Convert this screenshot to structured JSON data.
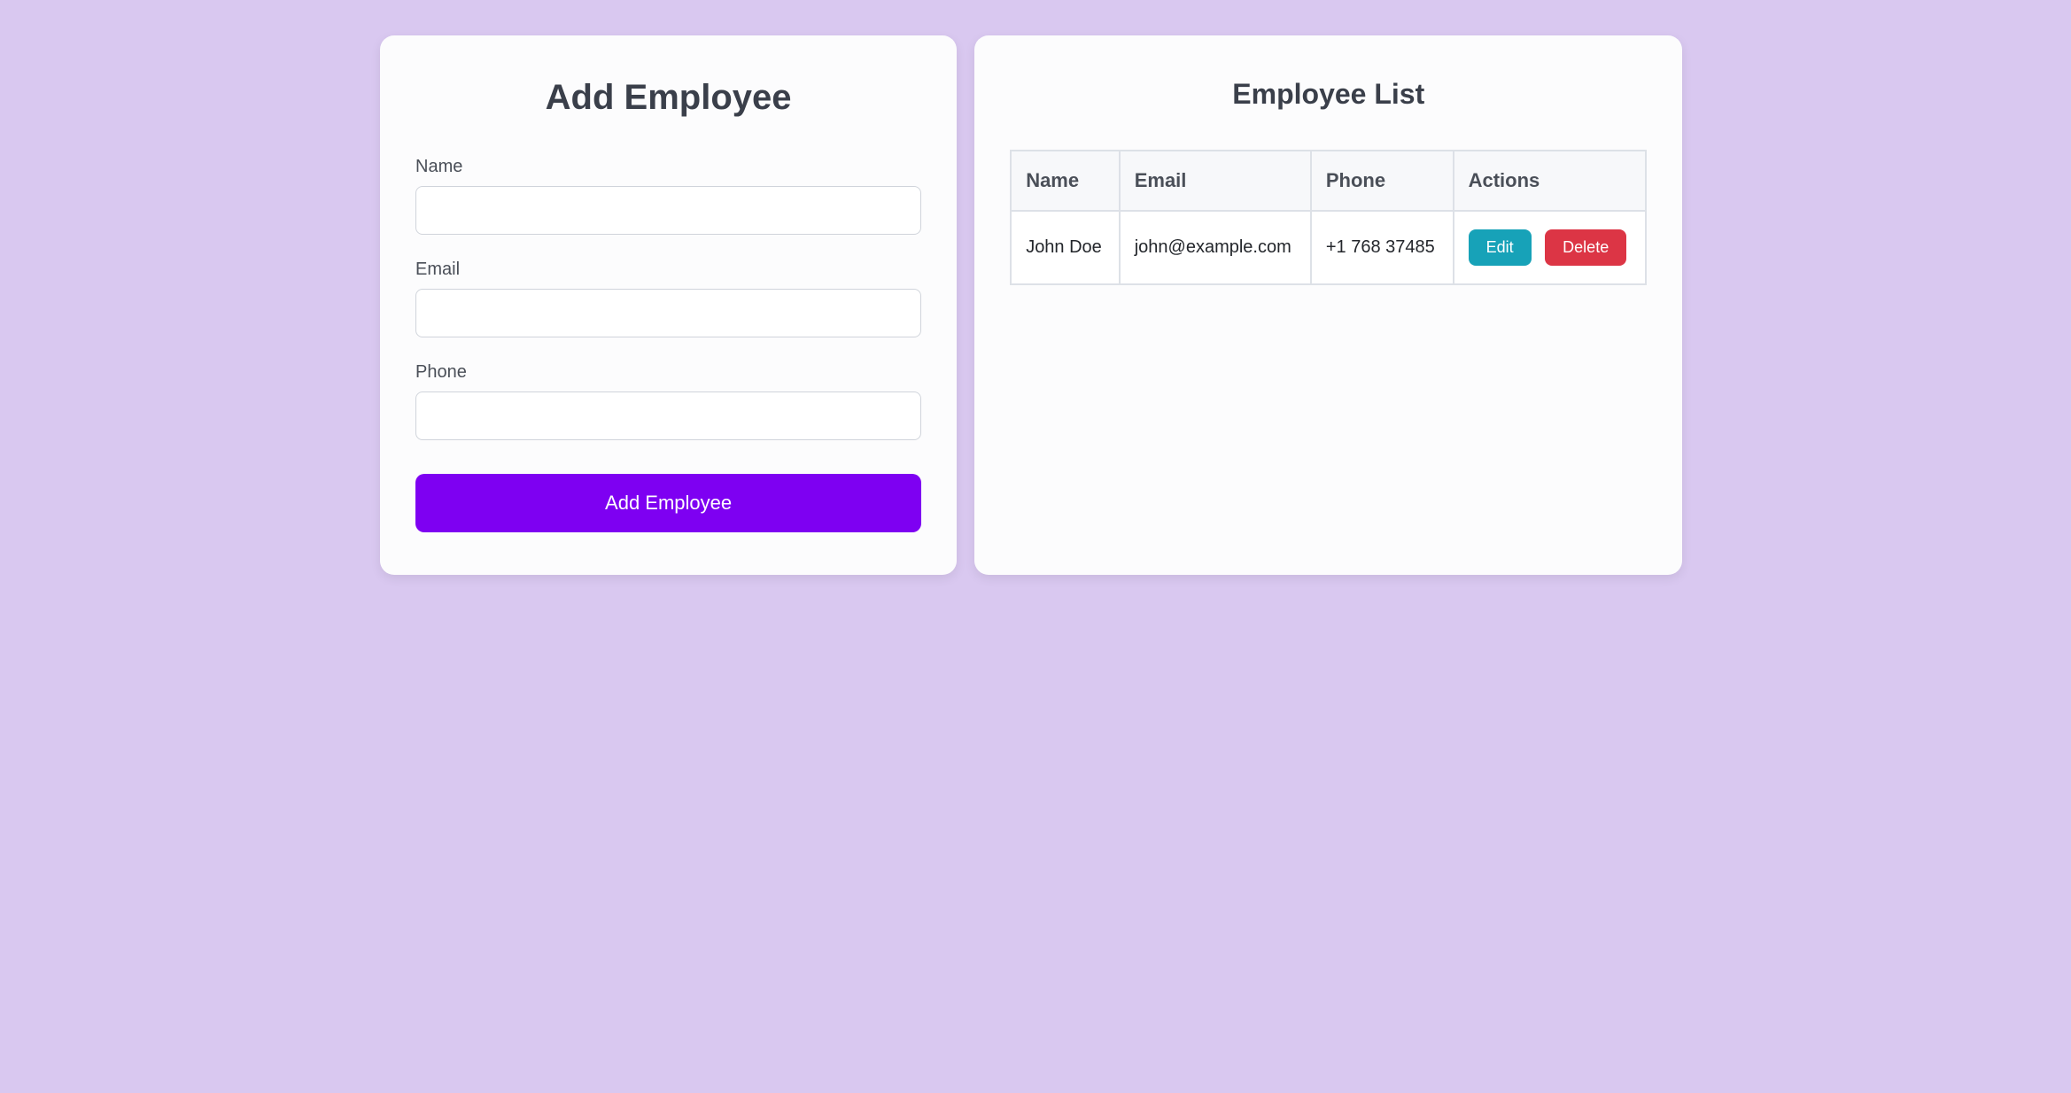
{
  "form": {
    "title": "Add Employee",
    "fields": {
      "name": {
        "label": "Name",
        "value": ""
      },
      "email": {
        "label": "Email",
        "value": ""
      },
      "phone": {
        "label": "Phone",
        "value": ""
      }
    },
    "submit_label": "Add Employee"
  },
  "list": {
    "title": "Employee List",
    "columns": {
      "name": "Name",
      "email": "Email",
      "phone": "Phone",
      "actions": "Actions"
    },
    "rows": [
      {
        "name": "John Doe",
        "email": "john@example.com",
        "phone": "+1 768 37485"
      }
    ],
    "actions": {
      "edit_label": "Edit",
      "delete_label": "Delete"
    }
  }
}
